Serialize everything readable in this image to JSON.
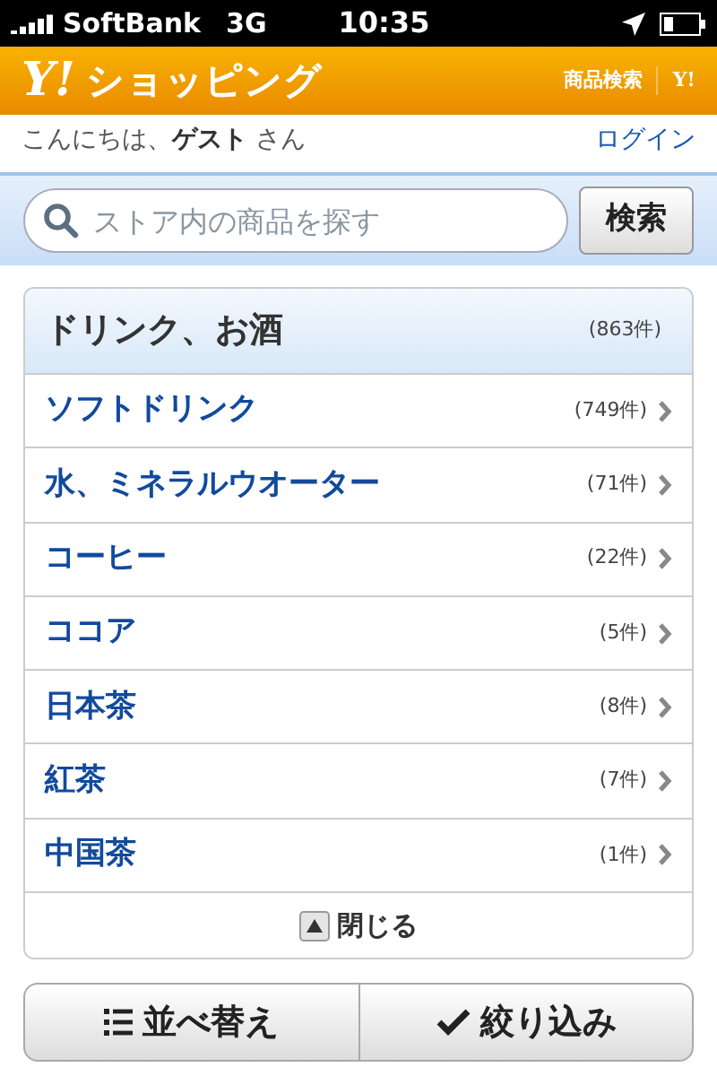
{
  "status_bar": {
    "carrier": "SoftBank",
    "network": "3G",
    "time": "10:35"
  },
  "header": {
    "logo_mark": "Y!",
    "logo_text": "ショッピング",
    "link": "商品検索",
    "small_logo": "Y!"
  },
  "greeting": {
    "prefix": "こんにちは、",
    "name": "ゲスト",
    "suffix": "さん",
    "login": "ログイン"
  },
  "search": {
    "placeholder": "ストア内の商品を探す",
    "button": "検索"
  },
  "category": {
    "title": "ドリンク、お酒",
    "count": "(863件)",
    "items": [
      {
        "label": "ソフトドリンク",
        "count": "(749件)"
      },
      {
        "label": "水、ミネラルウオーター",
        "count": "(71件)"
      },
      {
        "label": "コーヒー",
        "count": "(22件)"
      },
      {
        "label": "ココア",
        "count": "(5件)"
      },
      {
        "label": "日本茶",
        "count": "(8件)"
      },
      {
        "label": "紅茶",
        "count": "(7件)"
      },
      {
        "label": "中国茶",
        "count": "(1件)"
      }
    ],
    "close": "閉じる"
  },
  "actions": {
    "sort": "並べ替え",
    "filter": "絞り込み"
  }
}
